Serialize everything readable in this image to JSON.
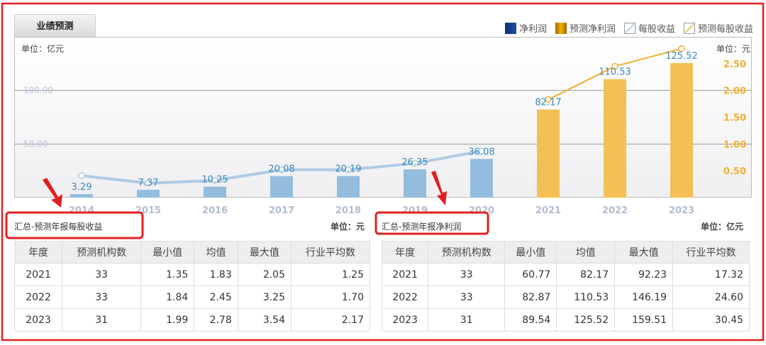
{
  "tab": {
    "label": "业绩预测"
  },
  "legend": [
    {
      "label": "净利润",
      "color": "#0d2f7a",
      "icon": "solid-swatch"
    },
    {
      "label": "预测净利润",
      "color": "#e0a000",
      "icon": "solid-swatch"
    },
    {
      "label": "每股收益",
      "color": "#9fbfdc",
      "icon": "line-swatch"
    },
    {
      "label": "预测每股收益",
      "color": "#f0b030",
      "icon": "line-swatch"
    }
  ],
  "chart_data": {
    "type": "bar",
    "left_unit": "单位：亿元",
    "right_unit": "单位：元",
    "categories": [
      "2014",
      "2015",
      "2016",
      "2017",
      "2018",
      "2019",
      "2020",
      "2021",
      "2022",
      "2023"
    ],
    "left_axis": {
      "ylim": [
        0,
        150
      ],
      "ticks": [
        "50.00",
        "100.00"
      ],
      "tick_values": [
        50,
        100
      ]
    },
    "right_axis": {
      "ylim": [
        0,
        3
      ],
      "ticks": [
        "0.50",
        "1.00",
        "1.50",
        "2.00",
        "2.50"
      ],
      "tick_values": [
        0.5,
        1,
        1.5,
        2,
        2.5
      ]
    },
    "series": [
      {
        "name": "净利润",
        "kind": "bar",
        "color": "#94bcdc",
        "values": [
          3.29,
          7.37,
          10.25,
          20.08,
          20.19,
          26.35,
          36.08,
          null,
          null,
          null
        ],
        "labels": [
          "3.29",
          "7.37",
          "10.25",
          "20.08",
          "20.19",
          "26.35",
          "36.08",
          null,
          null,
          null
        ]
      },
      {
        "name": "预测净利润",
        "kind": "bar",
        "color": "#f2c055",
        "values": [
          null,
          null,
          null,
          null,
          null,
          null,
          null,
          82.17,
          110.53,
          125.52
        ],
        "labels": [
          null,
          null,
          null,
          null,
          null,
          null,
          null,
          "82.17",
          "110.53",
          "125.52"
        ]
      },
      {
        "name": "每股收益",
        "kind": "line",
        "axis": "right",
        "color": "#b0cbe3",
        "values": [
          0.41,
          0.27,
          0.32,
          0.52,
          0.52,
          0.64,
          0.87,
          null,
          null,
          null
        ]
      },
      {
        "name": "预测每股收益",
        "kind": "line",
        "axis": "right",
        "color": "#f0b030",
        "values": [
          null,
          null,
          null,
          null,
          null,
          null,
          null,
          1.83,
          2.45,
          2.78
        ]
      }
    ],
    "grid": true,
    "legend_position": "top-right"
  },
  "eps_table": {
    "title": "汇总-预测年报每股收益",
    "unit": "单位：元",
    "headers": [
      "年度",
      "预测机构数",
      "最小值",
      "均值",
      "最大值",
      "行业平均数"
    ],
    "rows": [
      [
        "2021",
        "33",
        "1.35",
        "1.83",
        "2.05",
        "1.25"
      ],
      [
        "2022",
        "33",
        "1.84",
        "2.45",
        "3.25",
        "1.70"
      ],
      [
        "2023",
        "31",
        "1.99",
        "2.78",
        "3.54",
        "2.17"
      ]
    ]
  },
  "profit_table": {
    "title": "汇总-预测年报净利润",
    "unit": "单位：亿元",
    "headers": [
      "年度",
      "预测机构数",
      "最小值",
      "均值",
      "最大值",
      "行业平均数"
    ],
    "rows": [
      [
        "2021",
        "33",
        "60.77",
        "82.17",
        "92.23",
        "17.32"
      ],
      [
        "2022",
        "33",
        "82.87",
        "110.53",
        "146.19",
        "24.60"
      ],
      [
        "2023",
        "31",
        "89.54",
        "125.52",
        "159.51",
        "30.45"
      ]
    ]
  },
  "annotation_color": "#e02020"
}
